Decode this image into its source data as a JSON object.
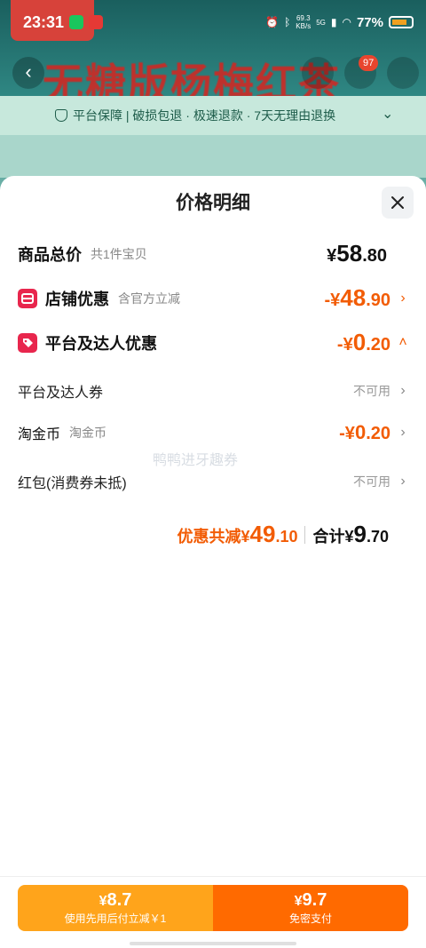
{
  "status_bar": {
    "time": "23:31",
    "net_speed_value": "69.3",
    "net_speed_unit": "KB/s",
    "network": "5G",
    "battery": "77%"
  },
  "background": {
    "title": "无糖版杨梅红茶",
    "cart_count": "97",
    "guarantee": "平台保障 | 破损包退 · 极速退款 · 7天无理由退换"
  },
  "sheet": {
    "title": "价格明细",
    "total": {
      "label": "商品总价",
      "sub": "共1件宝贝",
      "yen": "¥",
      "int": "58",
      "dec": ".80"
    },
    "shop_discount": {
      "label": "店铺优惠",
      "sub": "含官方立减",
      "prefix": "-¥",
      "int": "48",
      "dec": ".90"
    },
    "platform_discount": {
      "label": "平台及达人优惠",
      "prefix": "-¥",
      "int": "0",
      "dec": ".20"
    },
    "coupon": {
      "label": "平台及达人券",
      "status": "不可用"
    },
    "taojinbi": {
      "label": "淘金币",
      "sub": "淘金币",
      "prefix": "-¥",
      "int": "0",
      "dec": ".20"
    },
    "red_packet": {
      "label": "红包(消费券未抵)",
      "status": "不可用"
    },
    "watermark": "鸭鸭进牙趣券",
    "summary": {
      "disc_label": "优惠共减¥",
      "disc_int": "49",
      "disc_dec": ".10",
      "total_label": "合计¥",
      "total_int": "9",
      "total_dec": ".70"
    }
  },
  "pay": {
    "left_amount": "8.7",
    "left_sub": "使用先用后付立减￥1",
    "right_amount": "9.7",
    "right_sub": "免密支付",
    "yen": "¥"
  },
  "colors": {
    "accent": "#f25c05",
    "pay_left": "#ffa41b",
    "pay_right": "#ff6a00",
    "tag": "#e8264d"
  }
}
